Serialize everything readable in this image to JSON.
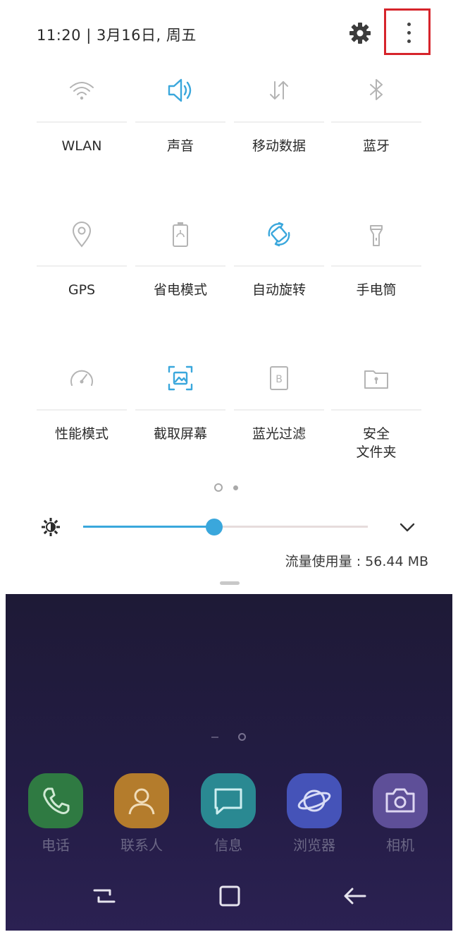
{
  "status_bar": {
    "time_date": "11:20 | 3月16日, 周五"
  },
  "quick_tiles": [
    {
      "label": "WLAN",
      "icon": "wifi-icon",
      "active": false
    },
    {
      "label": "声音",
      "icon": "speaker-icon",
      "active": true
    },
    {
      "label": "移动数据",
      "icon": "mobile-data-icon",
      "active": false
    },
    {
      "label": "蓝牙",
      "icon": "bluetooth-icon",
      "active": false
    },
    {
      "label": "GPS",
      "icon": "location-pin-icon",
      "active": false
    },
    {
      "label": "省电模式",
      "icon": "battery-saver-icon",
      "active": false
    },
    {
      "label": "自动旋转",
      "icon": "auto-rotate-icon",
      "active": true
    },
    {
      "label": "手电筒",
      "icon": "flashlight-icon",
      "active": false
    },
    {
      "label": "性能模式",
      "icon": "speedometer-icon",
      "active": false
    },
    {
      "label": "截取屏幕",
      "icon": "screenshot-icon",
      "active": true
    },
    {
      "label": "蓝光过滤",
      "icon": "blue-light-filter-icon",
      "active": false
    },
    {
      "label": "安全\n文件夹",
      "icon": "secure-folder-icon",
      "active": false
    }
  ],
  "pager": {
    "pages": 2,
    "current": 1
  },
  "brightness": {
    "level": 0.46
  },
  "data_usage": {
    "text": "流量使用量 : 56.44 MB"
  },
  "dock": [
    {
      "label": "电话",
      "icon": "phone-icon",
      "color": "#2f8a44"
    },
    {
      "label": "联系人",
      "icon": "contacts-icon",
      "color": "#c7882c"
    },
    {
      "label": "信息",
      "icon": "messages-icon",
      "color": "#2f9aa3"
    },
    {
      "label": "浏览器",
      "icon": "browser-icon",
      "color": "#4d5bc4"
    },
    {
      "label": "相机",
      "icon": "camera-icon",
      "color": "#6a5aa8"
    }
  ],
  "colors": {
    "accent": "#3aa7dc",
    "icon_inactive": "#a8a8a8",
    "highlight_box": "#d6242b"
  }
}
